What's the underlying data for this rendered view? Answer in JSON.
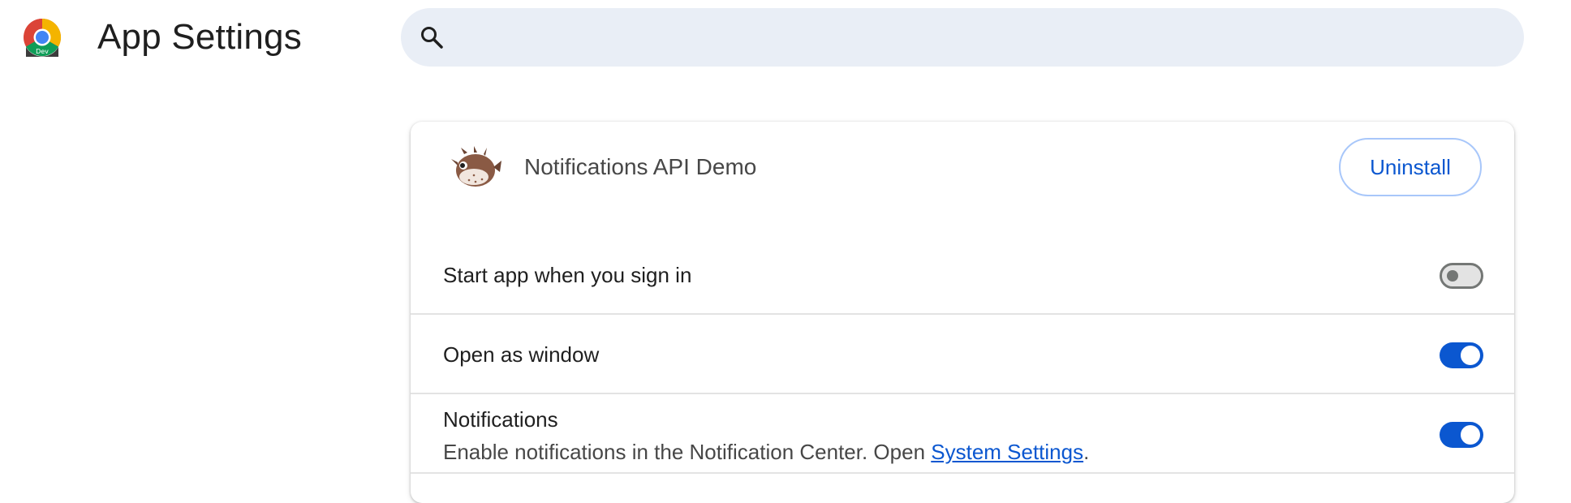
{
  "header": {
    "title": "App Settings",
    "logo_badge": "Dev",
    "search_placeholder": "",
    "search_value": ""
  },
  "app": {
    "name": "Notifications API Demo",
    "uninstall_label": "Uninstall"
  },
  "settings": [
    {
      "label": "Start app when you sign in",
      "enabled": false
    },
    {
      "label": "Open as window",
      "enabled": true
    },
    {
      "label": "Notifications",
      "description_prefix": "Enable notifications in the Notification Center. Open ",
      "description_link": "System Settings",
      "description_suffix": ".",
      "enabled": true
    }
  ],
  "colors": {
    "accent": "#0b57d0",
    "search_bg": "#e9eef6",
    "button_border": "#a8c7fa"
  },
  "icons": {
    "logo": "chrome-dev-logo-icon",
    "search": "search-icon",
    "app": "pufferfish-app-icon"
  }
}
